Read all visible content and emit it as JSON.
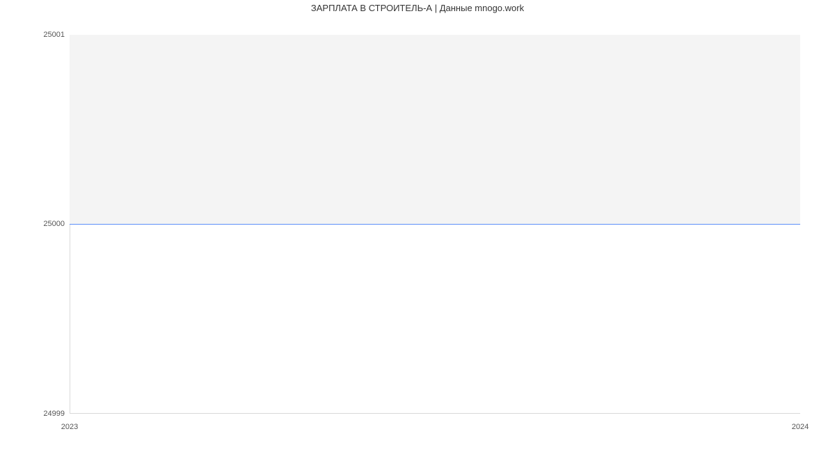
{
  "chart_data": {
    "type": "line",
    "title": "ЗАРПЛАТА В СТРОИТЕЛЬ-А | Данные mnogo.work",
    "x": [
      2023,
      2024
    ],
    "series": [
      {
        "name": "salary",
        "values": [
          25000,
          25000
        ],
        "color": "#5b8ff9"
      }
    ],
    "xticks": [
      "2023",
      "2024"
    ],
    "yticks": [
      "24999",
      "25000",
      "25001"
    ],
    "ylim": [
      24999,
      25001
    ],
    "xlabel": "",
    "ylabel": "",
    "plot_band_color": "#f4f4f4"
  }
}
